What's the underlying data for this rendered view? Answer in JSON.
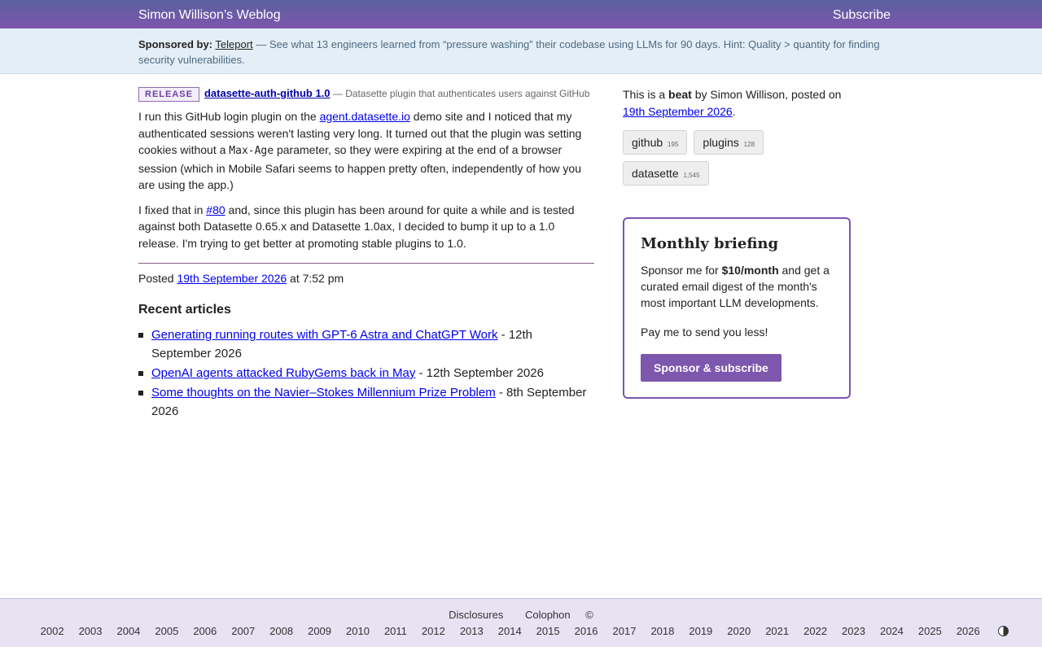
{
  "header": {
    "site_title": "Simon Willison’s Weblog",
    "subscribe": "Subscribe"
  },
  "sponsor": {
    "label": "Sponsored by:",
    "name": "Teleport",
    "text": " — See what 13 engineers learned from “pressure washing” their codebase using LLMs for 90 days. Hint: Quality > quantity for finding security vulnerabilities."
  },
  "release": {
    "badge": "RELEASE",
    "title": "datasette-auth-github 1.0",
    "description": " — Datasette plugin that authenticates users against GitHub"
  },
  "body": {
    "p1_a": "I run this GitHub login plugin on the ",
    "p1_link": "agent.datasette.io",
    "p1_b": " demo site and I noticed that my authenticated sessions weren't lasting very long. It turned out that the plugin was setting cookies without a ",
    "p1_code": "Max-Age",
    "p1_c": " parameter, so they were expiring at the end of a browser session (which in Mobile Safari seems to happen pretty often, independently of how you are using the app.)",
    "p2_a": "I fixed that in ",
    "p2_link": "#80",
    "p2_b": " and, since this plugin has been around for quite a while and is tested against both Datasette 0.65.x and Datasette 1.0ax, I decided to bump it up to a 1.0 release. I'm trying to get better at promoting stable plugins to 1.0."
  },
  "posted": {
    "label": "Posted ",
    "date": "19th September 2026",
    "time": " at 7:52 pm"
  },
  "recent": {
    "title": "Recent articles",
    "items": [
      {
        "title": "Generating running routes with GPT-6 Astra and ChatGPT Work",
        "date": " - 12th September 2026"
      },
      {
        "title": "OpenAI agents attacked RubyGems back in May",
        "date": " - 12th September 2026"
      },
      {
        "title": "Some thoughts on the Navier–Stokes Millennium Prize Problem",
        "date": " - 8th September 2026"
      }
    ]
  },
  "side": {
    "beat_a": "This is a ",
    "beat_b": "beat",
    "beat_c": " by Simon Willison, posted on ",
    "beat_date": "19th September 2026",
    "beat_end": ".",
    "tags": [
      {
        "name": "github",
        "count": "195"
      },
      {
        "name": "plugins",
        "count": "128"
      },
      {
        "name": "datasette",
        "count": "1,545"
      }
    ]
  },
  "briefing": {
    "title": "Monthly briefing",
    "p1_a": "Sponsor me for ",
    "p1_b": "$10/month",
    "p1_c": " and get a curated email digest of the month's most important LLM developments.",
    "p2": "Pay me to send you less!",
    "button": "Sponsor & subscribe"
  },
  "footer": {
    "disclosures": "Disclosures",
    "colophon": "Colophon",
    "copyright": "©",
    "years": [
      "2002",
      "2003",
      "2004",
      "2005",
      "2006",
      "2007",
      "2008",
      "2009",
      "2010",
      "2011",
      "2012",
      "2013",
      "2014",
      "2015",
      "2016",
      "2017",
      "2018",
      "2019",
      "2020",
      "2021",
      "2022",
      "2023",
      "2024",
      "2025",
      "2026"
    ]
  },
  "colors": {
    "accent": "#7d56ad",
    "header_start": "#5b5f9e",
    "sponsor_bg": "#e4eef7",
    "footer_bg": "#e8e3f3"
  },
  "icons": {
    "contrast": "contrast-toggle-icon"
  }
}
